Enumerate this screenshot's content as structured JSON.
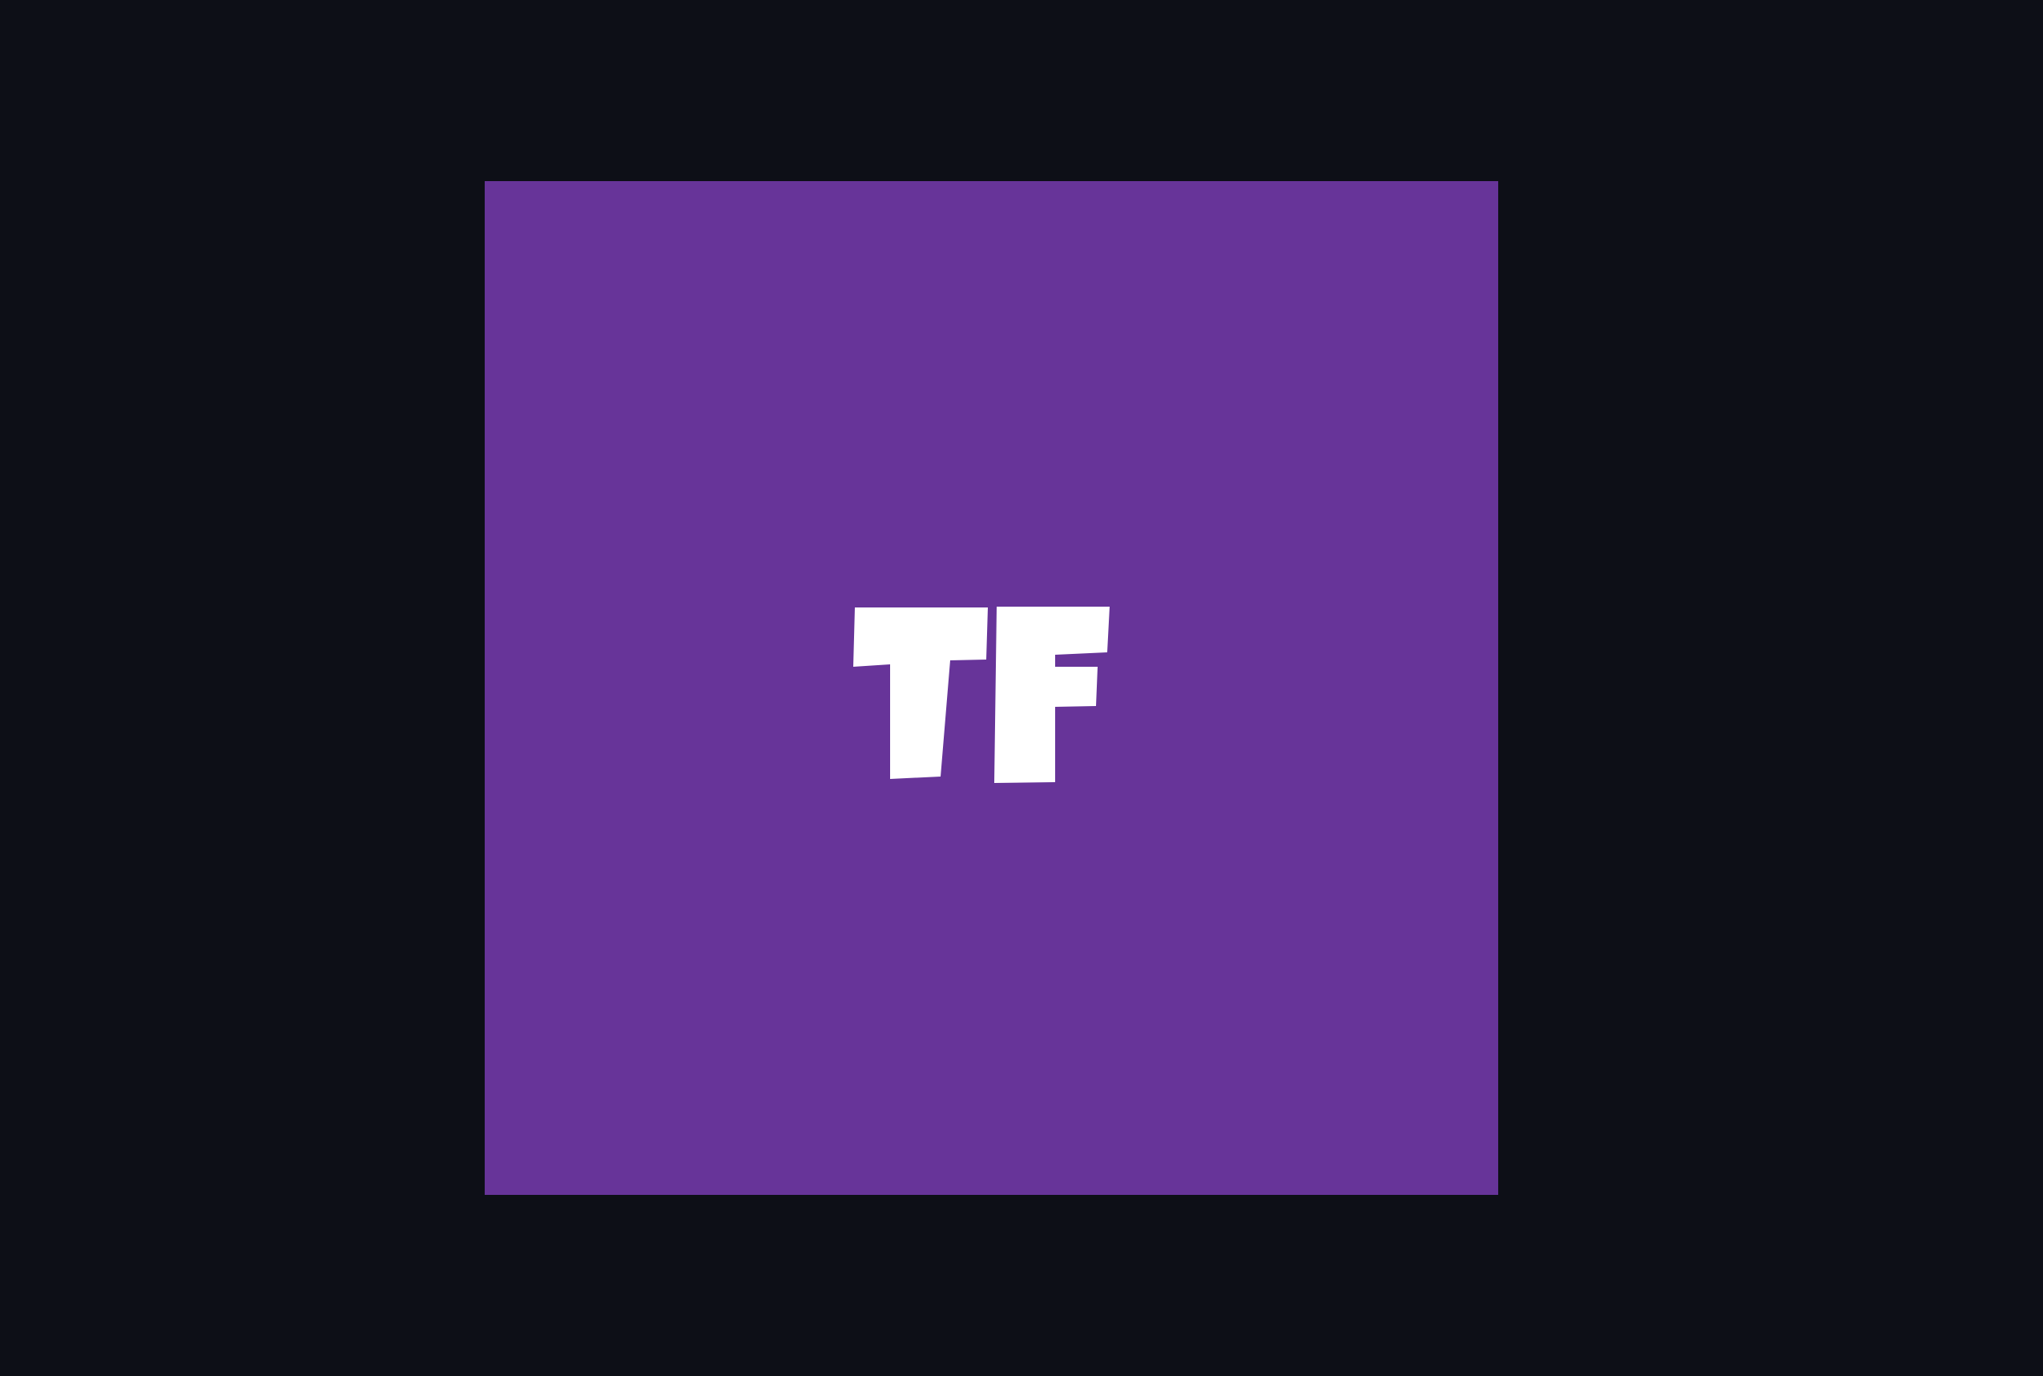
{
  "window": {
    "background_color": "#0d0f17"
  },
  "app_icon": {
    "logo_text": "TF",
    "background_color": "#673499",
    "glyph_color": "#ffffff"
  }
}
